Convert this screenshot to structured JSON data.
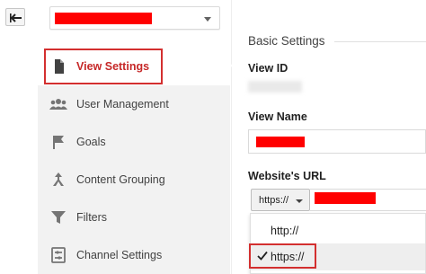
{
  "header": {
    "back_icon": "back-arrow-icon",
    "view_selector": {
      "redacted": true,
      "caret_icon": "chevron-down-icon"
    }
  },
  "sidebar": {
    "items": [
      {
        "label": "View Settings",
        "icon": "document-icon",
        "active": true
      },
      {
        "label": "User Management",
        "icon": "people-icon",
        "active": false
      },
      {
        "label": "Goals",
        "icon": "flag-icon",
        "active": false
      },
      {
        "label": "Content Grouping",
        "icon": "grouping-icon",
        "active": false
      },
      {
        "label": "Filters",
        "icon": "filter-icon",
        "active": false
      },
      {
        "label": "Channel Settings",
        "icon": "channel-settings-icon",
        "active": false
      }
    ]
  },
  "main": {
    "section_title": "Basic Settings",
    "view_id_label": "View ID",
    "view_name_label": "View Name",
    "website_url_label": "Website's URL",
    "protocol_select": {
      "selected": "https://",
      "options": [
        "http://",
        "https://"
      ]
    }
  },
  "colors": {
    "accent_red": "#d32f2f",
    "redaction": "#ff0000",
    "sidebar_bg": "#f2f2f2"
  }
}
